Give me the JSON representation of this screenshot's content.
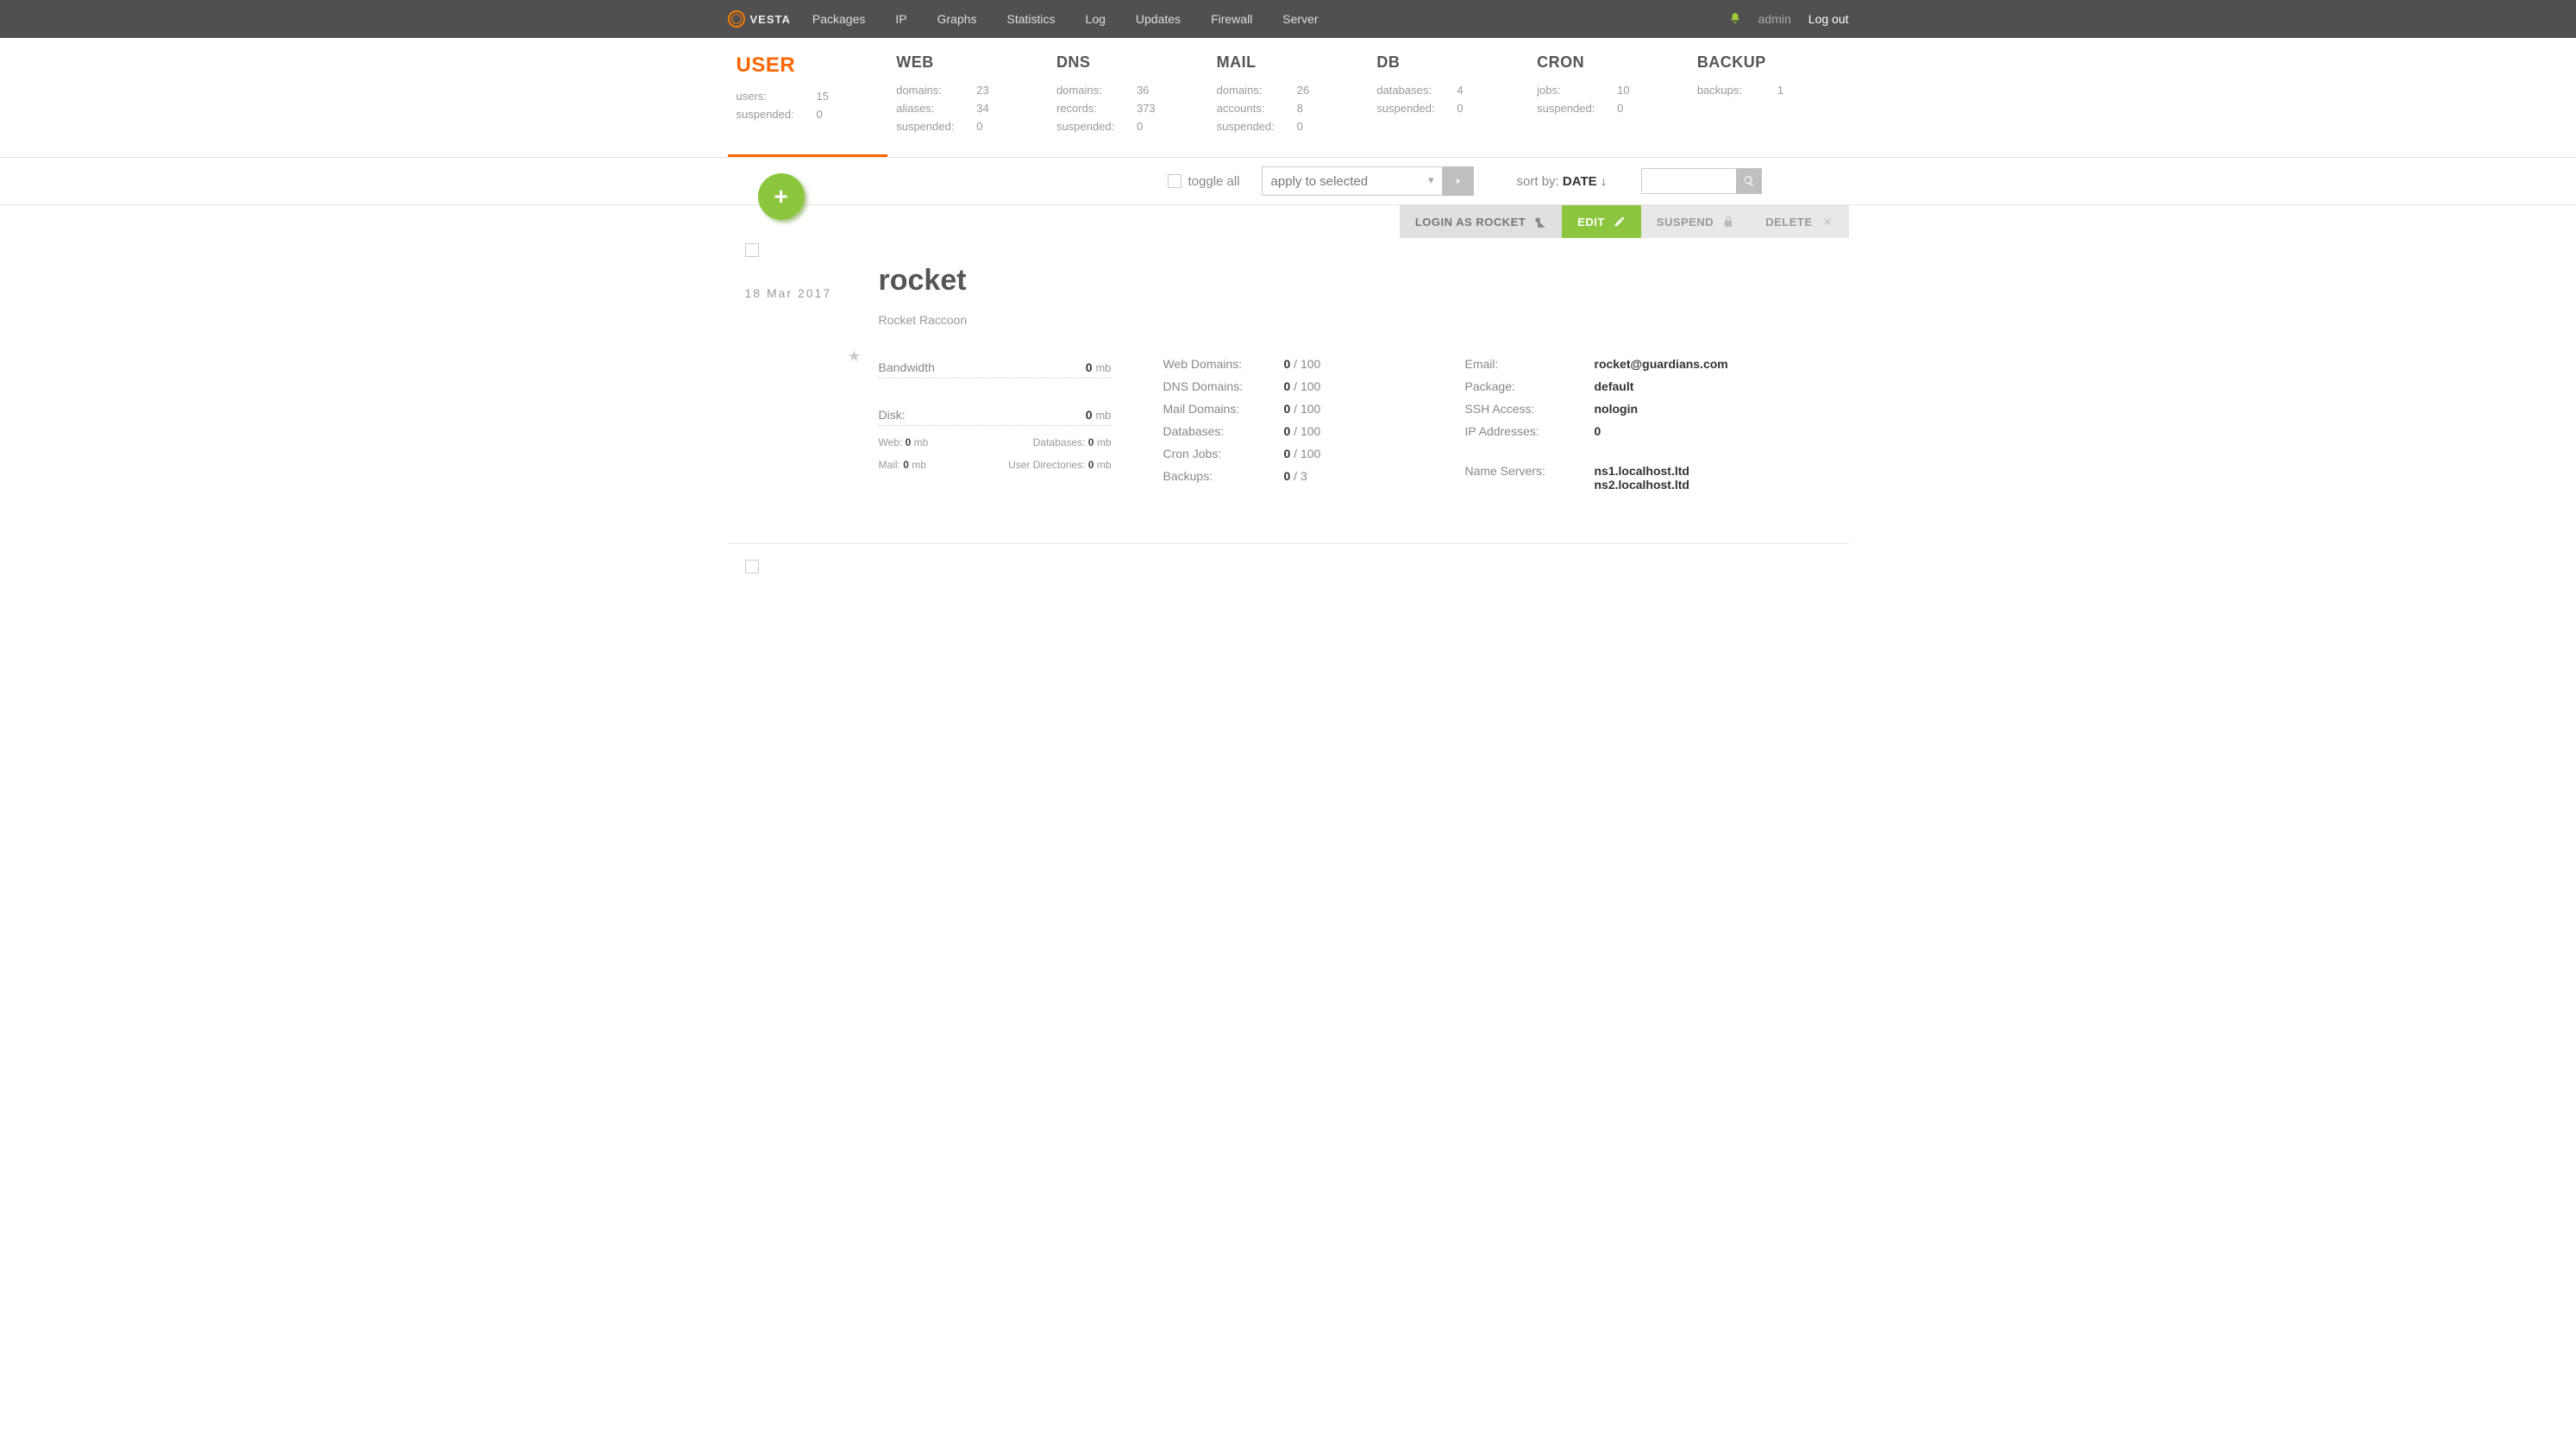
{
  "brand": "VESTA",
  "topnav": [
    "Packages",
    "IP",
    "Graphs",
    "Statistics",
    "Log",
    "Updates",
    "Firewall",
    "Server"
  ],
  "top_user": "admin",
  "logout": "Log out",
  "cats": [
    {
      "name": "USER",
      "active": true,
      "rows": [
        {
          "lbl": "users:",
          "val": "15"
        },
        {
          "lbl": "suspended:",
          "val": "0"
        }
      ]
    },
    {
      "name": "WEB",
      "active": false,
      "rows": [
        {
          "lbl": "domains:",
          "val": "23"
        },
        {
          "lbl": "aliases:",
          "val": "34"
        },
        {
          "lbl": "suspended:",
          "val": "0"
        }
      ]
    },
    {
      "name": "DNS",
      "active": false,
      "rows": [
        {
          "lbl": "domains:",
          "val": "36"
        },
        {
          "lbl": "records:",
          "val": "373"
        },
        {
          "lbl": "suspended:",
          "val": "0"
        }
      ]
    },
    {
      "name": "MAIL",
      "active": false,
      "rows": [
        {
          "lbl": "domains:",
          "val": "26"
        },
        {
          "lbl": "accounts:",
          "val": "8"
        },
        {
          "lbl": "suspended:",
          "val": "0"
        }
      ]
    },
    {
      "name": "DB",
      "active": false,
      "rows": [
        {
          "lbl": "databases:",
          "val": "4"
        },
        {
          "lbl": "suspended:",
          "val": "0"
        }
      ]
    },
    {
      "name": "CRON",
      "active": false,
      "rows": [
        {
          "lbl": "jobs:",
          "val": "10"
        },
        {
          "lbl": "suspended:",
          "val": "0"
        }
      ]
    },
    {
      "name": "BACKUP",
      "active": false,
      "rows": [
        {
          "lbl": "backups:",
          "val": "1"
        }
      ]
    }
  ],
  "toolbar": {
    "toggle_all": "toggle all",
    "apply_placeholder": "apply to selected",
    "sort_prefix": "sort by:",
    "sort_field": "DATE",
    "sort_dir": "↓"
  },
  "actions": {
    "login_as": "LOGIN AS ROCKET",
    "edit": "EDIT",
    "suspend": "SUSPEND",
    "delete": "DELETE"
  },
  "item": {
    "date": "18 Mar 2017",
    "username": "rocket",
    "fullname": "Rocket Raccoon",
    "bandwidth_label": "Bandwidth",
    "bandwidth_val": "0",
    "bandwidth_unit": "mb",
    "disk_label": "Disk:",
    "disk_val": "0",
    "disk_unit": "mb",
    "disk_sub": {
      "web_lbl": "Web:",
      "web_val": "0",
      "web_unit": "mb",
      "db_lbl": "Databases:",
      "db_val": "0",
      "db_unit": "mb",
      "mail_lbl": "Mail:",
      "mail_val": "0",
      "mail_unit": "mb",
      "ud_lbl": "User Directories:",
      "ud_val": "0",
      "ud_unit": "mb"
    },
    "limits": [
      {
        "k": "Web Domains:",
        "u": "0",
        "lim": " / 100"
      },
      {
        "k": "DNS Domains:",
        "u": "0",
        "lim": " / 100"
      },
      {
        "k": "Mail Domains:",
        "u": "0",
        "lim": " / 100"
      },
      {
        "k": "Databases:",
        "u": "0",
        "lim": " / 100"
      },
      {
        "k": "Cron Jobs:",
        "u": "0",
        "lim": " / 100"
      },
      {
        "k": "Backups:",
        "u": "0",
        "lim": " / 3"
      }
    ],
    "info": [
      {
        "k": "Email:",
        "v": "rocket@guardians.com"
      },
      {
        "k": "Package:",
        "v": "default"
      },
      {
        "k": "SSH Access:",
        "v": "nologin"
      },
      {
        "k": "IP Addresses:",
        "v": "0"
      }
    ],
    "ns_label": "Name Servers:",
    "ns": [
      "ns1.localhost.ltd",
      "ns2.localhost.ltd"
    ]
  }
}
